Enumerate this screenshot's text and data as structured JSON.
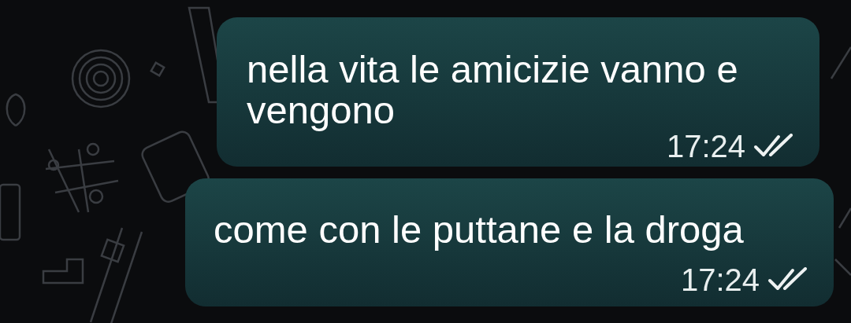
{
  "messages": [
    {
      "text": "nella vita le amicizie vanno e vengono",
      "time": "17:24",
      "read": false
    },
    {
      "text": "come con le puttane e la droga",
      "time": "17:24",
      "read": false
    }
  ]
}
